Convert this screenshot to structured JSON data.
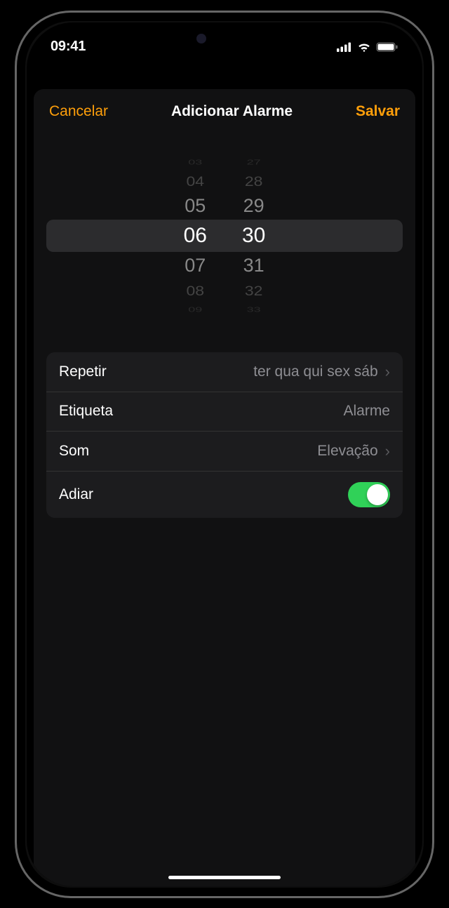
{
  "status": {
    "time": "09:41"
  },
  "sheet": {
    "cancel": "Cancelar",
    "title": "Adicionar Alarme",
    "save": "Salvar"
  },
  "picker": {
    "hours": {
      "m3": "03",
      "m2": "04",
      "m1": "05",
      "sel": "06",
      "p1": "07",
      "p2": "08",
      "p3": "09"
    },
    "minutes": {
      "m3": "27",
      "m2": "28",
      "m1": "29",
      "sel": "30",
      "p1": "31",
      "p2": "32",
      "p3": "33"
    }
  },
  "options": {
    "repeat": {
      "label": "Repetir",
      "value": "ter qua qui sex sáb"
    },
    "tag": {
      "label": "Etiqueta",
      "value": "Alarme"
    },
    "sound": {
      "label": "Som",
      "value": "Elevação"
    },
    "snooze": {
      "label": "Adiar",
      "on": true
    }
  }
}
